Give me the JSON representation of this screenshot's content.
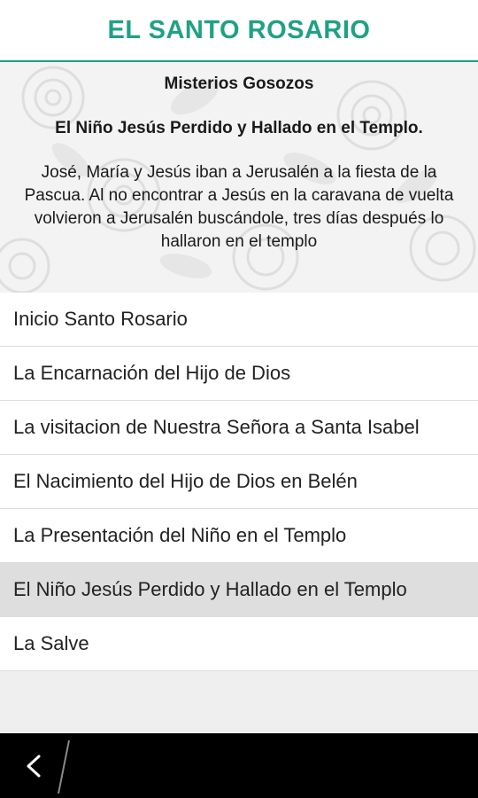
{
  "app": {
    "title": "EL SANTO ROSARIO"
  },
  "header": {
    "section": "Misterios Gosozos",
    "mystery": "El Niño Jesús Perdido y Hallado en el Templo.",
    "description": "José, María y Jesús iban a Jerusalén a la fiesta de la Pascua. Al no encontrar a Jesús en la caravana de vuelta volvieron a Jerusalén buscándole, tres días después lo hallaron en el templo"
  },
  "list": {
    "items": [
      {
        "label": "Inicio Santo Rosario"
      },
      {
        "label": "La Encarnación del Hijo de Dios"
      },
      {
        "label": "La visitacion de Nuestra Señora a Santa Isabel"
      },
      {
        "label": "El Nacimiento del Hijo de Dios en Belén"
      },
      {
        "label": "La Presentación del Niño en el Templo"
      },
      {
        "label": "El Niño Jesús Perdido y Hallado en el Templo"
      },
      {
        "label": "La Salve"
      }
    ],
    "selected_index": 5
  },
  "navbar": {
    "back_icon": "chevron-left-icon"
  },
  "colors": {
    "accent": "#1fa184",
    "selected_row": "#dedede",
    "navbar": "#000000"
  }
}
